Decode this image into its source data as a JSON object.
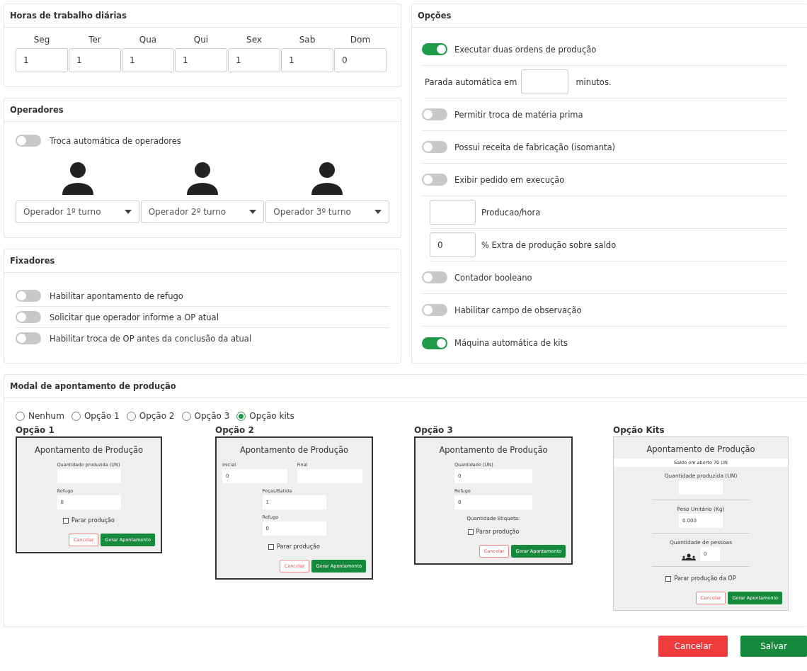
{
  "hours": {
    "title": "Horas de trabalho diárias",
    "days": [
      {
        "label": "Seg",
        "value": "1"
      },
      {
        "label": "Ter",
        "value": "1"
      },
      {
        "label": "Qua",
        "value": "1"
      },
      {
        "label": "Qui",
        "value": "1"
      },
      {
        "label": "Sex",
        "value": "1"
      },
      {
        "label": "Sab",
        "value": "1"
      },
      {
        "label": "Dom",
        "value": "0"
      }
    ]
  },
  "operators": {
    "title": "Operadores",
    "toggle": {
      "label": "Troca automática de operadores",
      "on": false
    },
    "shifts": [
      {
        "placeholder": "Operador 1º turno"
      },
      {
        "placeholder": "Operador 2º turno"
      },
      {
        "placeholder": "Operador 3º turno"
      }
    ]
  },
  "fixers": {
    "title": "Fixadores",
    "toggles": [
      {
        "label": "Habilitar apontamento de refugo",
        "on": false
      },
      {
        "label": "Solicitar que operador informe a OP atual",
        "on": false
      },
      {
        "label": "Habilitar troca de OP antes da conclusão da atual",
        "on": false
      }
    ]
  },
  "options": {
    "title": "Opções",
    "rows": [
      {
        "kind": "toggle",
        "label": "Executar duas ordens de produção",
        "on": true
      },
      {
        "kind": "inline_input",
        "before": "Parada automática em",
        "after": "minutos."
      },
      {
        "kind": "toggle",
        "label": "Permitir troca de matéria prima",
        "on": false
      },
      {
        "kind": "toggle",
        "label": "Possui receita de fabricação (isomanta)",
        "on": false
      },
      {
        "kind": "toggle",
        "label": "Exibir pedido em execução",
        "on": false
      },
      {
        "kind": "input",
        "label": "Producao/hora"
      },
      {
        "kind": "input",
        "label": "% Extra de produção sobre saldo",
        "value": "0"
      },
      {
        "kind": "toggle",
        "label": "Contador booleano",
        "on": false
      },
      {
        "kind": "toggle",
        "label": "Habilitar campo de observação",
        "on": false
      },
      {
        "kind": "toggle",
        "label": "Máquina automática de kits",
        "on": true
      }
    ]
  },
  "modal_section": {
    "title": "Modal de apontamento de produção",
    "radios": [
      {
        "label": "Nenhum",
        "selected": false
      },
      {
        "label": "Opção 1",
        "selected": false
      },
      {
        "label": "Opção 2",
        "selected": false
      },
      {
        "label": "Opção 3",
        "selected": false
      },
      {
        "label": "Opção kits",
        "selected": true
      }
    ],
    "previews": [
      {
        "caption": "Opção 1",
        "heading": "Apontamento de Produção",
        "elements": [
          {
            "kind": "field",
            "label": "Quantidade produzida (UN)"
          },
          {
            "kind": "field",
            "label": "Refugo",
            "value": "0"
          },
          {
            "kind": "checkbox",
            "label": "Parar produção",
            "checked": false
          }
        ],
        "cancel": "Cancelar",
        "submit": "Gerar Apontamento"
      },
      {
        "caption": "Opção 2",
        "heading": "Apontamento de Produção",
        "elements": [
          {
            "kind": "pair",
            "fields": [
              {
                "label": "Inicial",
                "value": "0"
              },
              {
                "label": "Final"
              }
            ]
          },
          {
            "kind": "field",
            "label": "Peças/Batida",
            "value": "1"
          },
          {
            "kind": "field",
            "label": "Refugo",
            "value": "0"
          },
          {
            "kind": "checkbox",
            "label": "Parar produção",
            "checked": false
          }
        ],
        "cancel": "Cancelar",
        "submit": "Gerar Apontamento"
      },
      {
        "caption": "Opção 3",
        "heading": "Apontamento de Produção",
        "elements": [
          {
            "kind": "field",
            "label": "Quantidade (UN)",
            "value": "0"
          },
          {
            "kind": "field",
            "label": "Refugo",
            "value": "0"
          },
          {
            "kind": "note",
            "text": "Quantidade Etiqueta:"
          },
          {
            "kind": "checkbox",
            "label": "Parar produção",
            "checked": false
          }
        ],
        "cancel": "Cancelar",
        "submit": "Gerar Apontamento"
      },
      {
        "caption": "Opção Kits",
        "heading": "Apontamento de Produção",
        "elements": [
          {
            "kind": "banner",
            "text": "Saldo em aberto 70 UN"
          },
          {
            "kind": "centered_field",
            "label": "Quantidade produzida (UN)"
          },
          {
            "kind": "divider"
          },
          {
            "kind": "centered_field",
            "label": "Peso Unitário (Kg)",
            "value": "0.000"
          },
          {
            "kind": "divider"
          },
          {
            "kind": "people",
            "label": "Quantidade de pessoas",
            "value": "0"
          },
          {
            "kind": "divider"
          },
          {
            "kind": "checkbox",
            "label": "Parar produção da OP",
            "checked": false
          }
        ],
        "cancel": "Cancelar",
        "submit": "Gerar Apontamento"
      }
    ]
  },
  "footer": {
    "cancel": "Cancelar",
    "save": "Salvar"
  }
}
